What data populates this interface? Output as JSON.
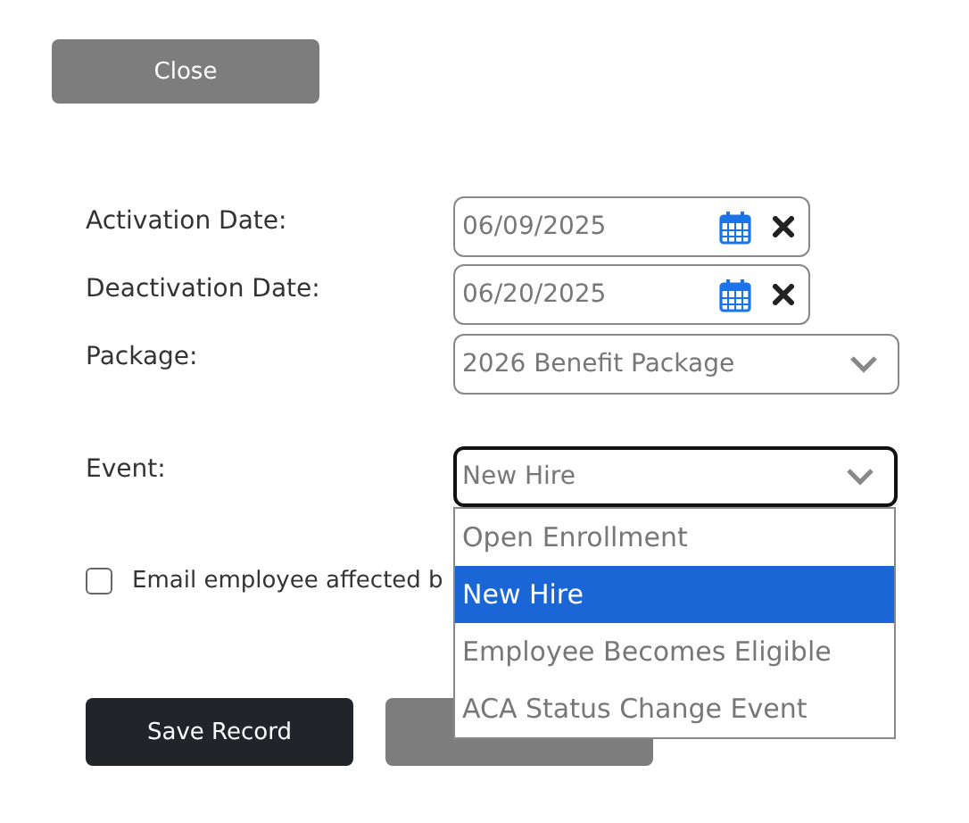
{
  "close_button": "Close",
  "fields": [
    {
      "kind": "date",
      "label": "Activation Date:",
      "value": "06/09/2025"
    },
    {
      "kind": "date",
      "label": "Deactivation Date:",
      "value": "06/20/2025"
    },
    {
      "kind": "select",
      "label": "Package:",
      "value": "2026 Benefit Package"
    }
  ],
  "event": {
    "label": "Event:",
    "value": "New Hire",
    "expanded": true,
    "options": [
      {
        "label": "Open Enrollment",
        "selected": false
      },
      {
        "label": "New Hire",
        "selected": true
      },
      {
        "label": "Employee Becomes Eligible",
        "selected": false
      },
      {
        "label": "ACA Status Change Event",
        "selected": false
      }
    ]
  },
  "email_checkbox": {
    "label": "Email employee affected b",
    "checked": false
  },
  "save_button": "Save Record"
}
